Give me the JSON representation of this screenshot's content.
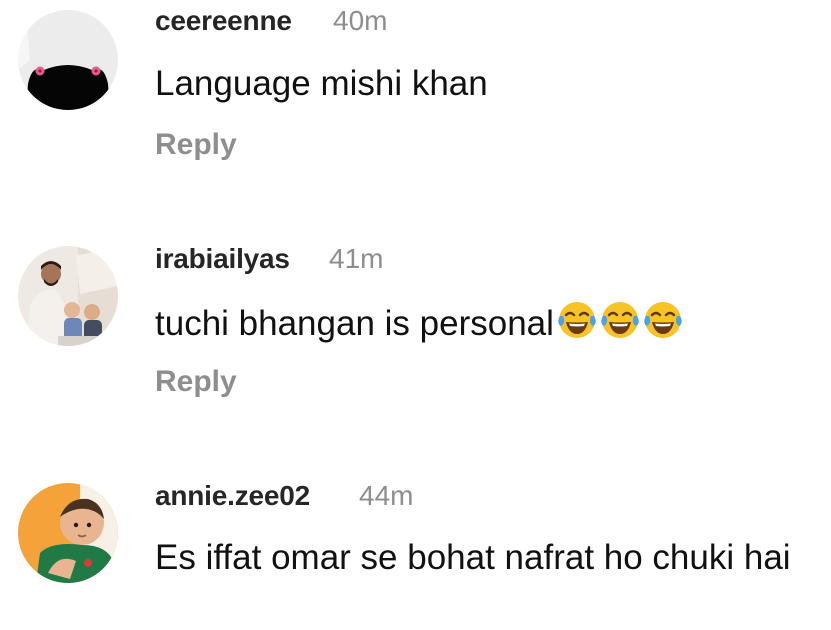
{
  "comments": [
    {
      "username": "ceereenne",
      "time": "40m",
      "text": "Language mishi khan",
      "reply_label": "Reply"
    },
    {
      "username": "irabiailyas",
      "time": "41m",
      "text": "tuchi bhangan is personal",
      "emoji_count": 3,
      "emoji": "face-with-tears-of-joy",
      "reply_label": "Reply"
    },
    {
      "username": "annie.zee02",
      "time": "44m",
      "text": "Es iffat omar se bohat nafrat ho chuki hai"
    }
  ],
  "colors": {
    "username": "#262626",
    "meta": "#8e8e8e",
    "text": "#111111",
    "emoji_face": "#f7c325"
  }
}
